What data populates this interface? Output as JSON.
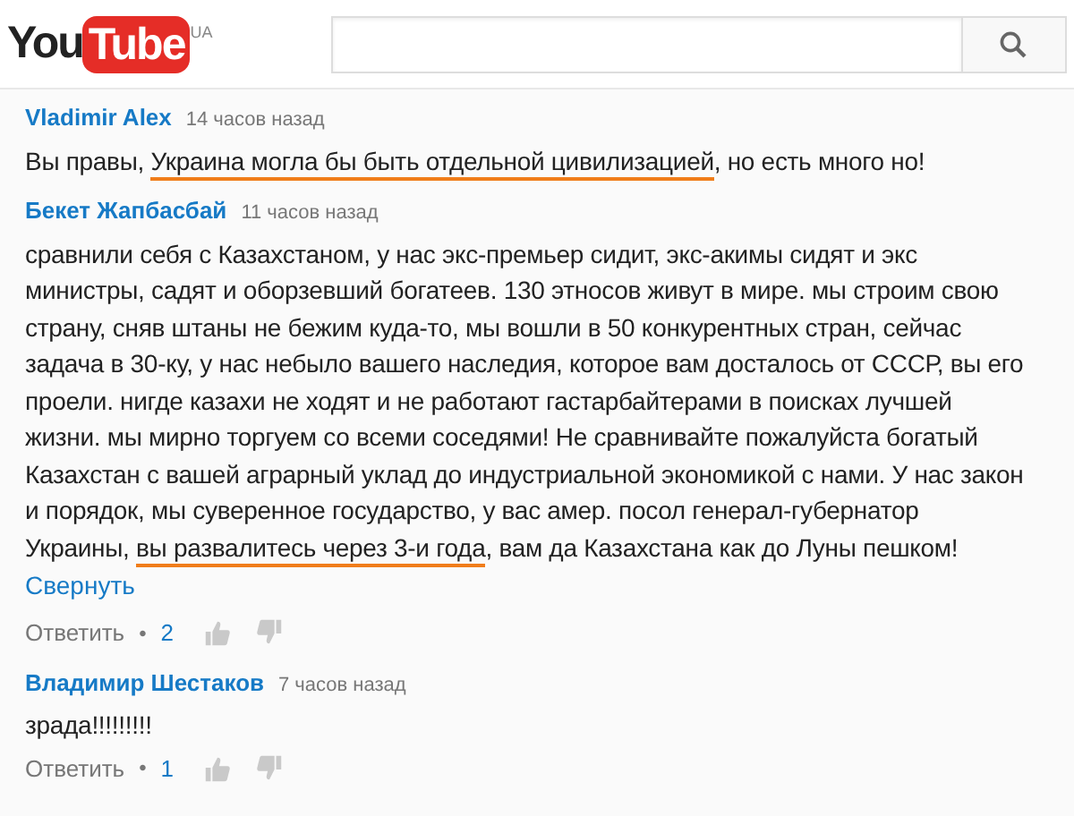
{
  "header": {
    "logo_left": "You",
    "logo_right": "Tube",
    "region": "UA"
  },
  "comments": [
    {
      "author": "Vladimir Alex",
      "time": "14 часов назад",
      "segments": [
        {
          "text": "Вы правы, ",
          "underlined": false
        },
        {
          "text": "Украина могла бы быть отдельной цивилизацией",
          "underlined": true
        },
        {
          "text": ", но есть много но!",
          "underlined": false
        }
      ]
    },
    {
      "author": "Бекет Жапбасбай",
      "time": "11 часов назад",
      "segments": [
        {
          "text": "сравнили себя с Казахстаном, у нас экс-премьер сидит, экс-акимы  сидят и экс министры, садят и оборзевший богатеев. 130 этносов живут в мире. мы строим свою страну, сняв штаны не бежим куда-то, мы вошли в 50 конкурентных стран, сейчас задача в 30-ку, у нас небыло вашего наследия, которое вам досталось от СССР, вы его проели. нигде казахи не ходят и не работают гастарбайтерами в поисках лучшей жизни. мы мирно торгуем со всеми соседями! Не сравнивайте пожалуйста богатый Казахстан с вашей аграрный уклад до индустриальной экономикой с нами. У нас закон и порядок, мы суверенное государство, у вас амер. посол генерал-губернатор Украины, ",
          "underlined": false
        },
        {
          "text": "вы развалитесь через 3-и года",
          "underlined": true
        },
        {
          "text": ", вам да Казахстана как до Луны пешком!",
          "underlined": false
        }
      ],
      "collapse": "Свернуть",
      "reply": "Ответить",
      "separator": "•",
      "likes": "2"
    },
    {
      "author": "Владимир Шестаков",
      "time": "7 часов назад",
      "segments": [
        {
          "text": "зрада!!!!!!!!!",
          "underlined": false
        }
      ],
      "reply": "Ответить",
      "separator": "•",
      "likes": "1"
    }
  ]
}
